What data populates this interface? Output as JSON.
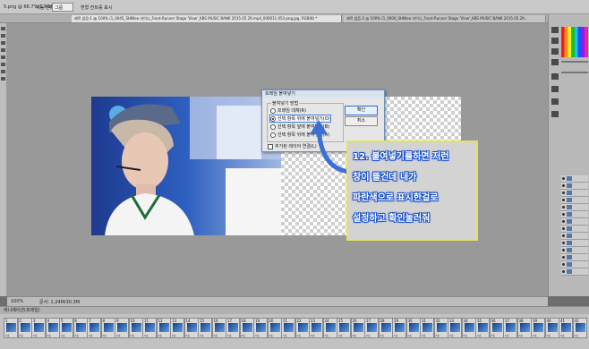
{
  "options_bar": {
    "menu_label": "5.png @ 66.7%(1,RGB/...",
    "auto_select_label": "자동 선택:",
    "group_value": "그룹",
    "transform_label": "변형 컨트롤 표시"
  },
  "tabs": [
    {
      "label": "제목 없음-1 @ 100% (1_0045_SHINee 샤이니_Front-Runner Stage 'View'_KBS MUSIC BANK 2015.05.29.mp4_000011.053.png.jpg, RGB/8) *"
    },
    {
      "label": "제목 없음-2 @ 100% (1_0000_SHINee 샤이니_Front-Runner Stage 'View'_KBS MUSIC BANK 2015.05.29..."
    }
  ],
  "dialog": {
    "title": "프레임 붙여넣기",
    "group_label": "붙여넣기 방법",
    "options": [
      {
        "label": "프레임 대체(R)",
        "selected": false
      },
      {
        "label": "선택 항목 위에 붙여넣기(O)",
        "selected": true
      },
      {
        "label": "선택 항목 앞에 붙여넣기(B)",
        "selected": false
      },
      {
        "label": "선택 항목 뒤에 붙여넣기(A)",
        "selected": false
      }
    ],
    "ok_label": "확인",
    "cancel_label": "취소",
    "checkbox_label": "추가된 레이어 연결(L)"
  },
  "note": {
    "lines": [
      "12. 붙여넣기를하면 저런",
      "창이 뜰건데 내가",
      "파란색으로 표시한걸로",
      "설정하고 확인눌러줘"
    ],
    "border_color": "#e8e25a",
    "text_outline_color": "#1850c8"
  },
  "status": {
    "zoom": "100%",
    "doc_info": "문서: 1.24M/30.3M"
  },
  "timeline": {
    "title": "애니메이션(프레임)",
    "frame_delay": "0초",
    "frames": [
      "1",
      "2",
      "3",
      "4",
      "5",
      "6",
      "7",
      "8",
      "9",
      "10",
      "11",
      "12",
      "13",
      "14",
      "15",
      "16",
      "17",
      "18",
      "19",
      "20",
      "21",
      "22",
      "23",
      "24",
      "25",
      "26",
      "27",
      "28",
      "29",
      "30",
      "31",
      "32",
      "33",
      "34",
      "35",
      "36",
      "37",
      "38",
      "39",
      "40",
      "41",
      "42"
    ]
  }
}
